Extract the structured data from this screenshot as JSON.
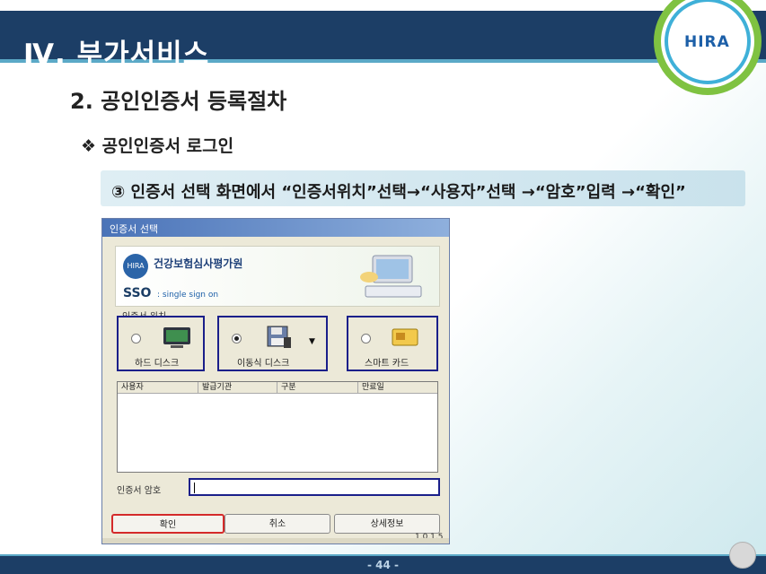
{
  "header": {
    "title": "Ⅳ. 부가서비스",
    "logo_text": "HIRA"
  },
  "section": {
    "heading": "2. 공인인증서 등록절차",
    "subheading": "❖ 공인인증서 로그인"
  },
  "instruction": {
    "text": "③ 인증서 선택 화면에서 “인증서위치”선택→“사용자”선택 →“암호”입력 →“확인”"
  },
  "dialog": {
    "title": "인증서 선택",
    "org_name": "건강보험심사평가원",
    "sso": "SSO",
    "sso_sub": ": single sign on",
    "location_label": "인증서 위치",
    "locations": [
      {
        "label": "하드 디스크",
        "selected": false,
        "icon": "monitor-icon"
      },
      {
        "label": "이동식 디스크",
        "selected": true,
        "icon": "floppy-disk-icon"
      },
      {
        "label": "스마트 카드",
        "selected": false,
        "icon": "smart-card-icon"
      }
    ],
    "columns": [
      "사용자",
      "발급기관",
      "구분",
      "만료일"
    ],
    "password_label": "인증서 암호",
    "password_value": "",
    "buttons": {
      "ok": "확인",
      "cancel": "취소",
      "details": "상세정보"
    },
    "version": "1,0,1,5"
  },
  "footer": {
    "page": "- 44 -"
  },
  "colors": {
    "title_bar": "#1c3e66",
    "highlight_red": "#d42a2a",
    "highlight_navy": "#1a1f8a"
  }
}
